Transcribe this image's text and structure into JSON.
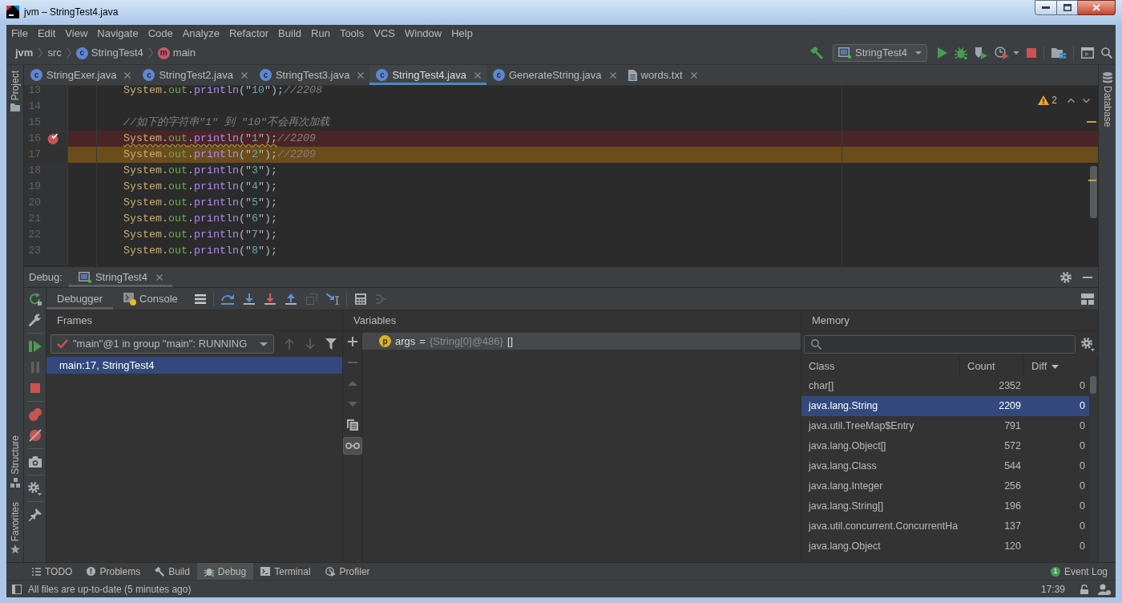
{
  "window": {
    "title": "jvm – StringTest4.java"
  },
  "menu": [
    "File",
    "Edit",
    "View",
    "Navigate",
    "Code",
    "Analyze",
    "Refactor",
    "Build",
    "Run",
    "Tools",
    "VCS",
    "Window",
    "Help"
  ],
  "breadcrumbs": [
    {
      "label": "jvm",
      "kind": "project"
    },
    {
      "label": "src",
      "kind": "folder"
    },
    {
      "label": "StringTest4",
      "kind": "class",
      "icon_letter": "c"
    },
    {
      "label": "main",
      "kind": "method",
      "icon_letter": "m"
    }
  ],
  "run_configuration": "StringTest4",
  "editor_tabs": [
    {
      "label": "StringExer.java",
      "kind": "class",
      "icon_letter": "c",
      "selected": false
    },
    {
      "label": "StringTest2.java",
      "kind": "class",
      "icon_letter": "c",
      "selected": false
    },
    {
      "label": "StringTest3.java",
      "kind": "class",
      "icon_letter": "c",
      "selected": false
    },
    {
      "label": "StringTest4.java",
      "kind": "class",
      "icon_letter": "c",
      "selected": true
    },
    {
      "label": "GenerateString.java",
      "kind": "class",
      "icon_letter": "c",
      "selected": false
    },
    {
      "label": "words.txt",
      "kind": "text",
      "selected": false
    }
  ],
  "left_tool_windows": [
    {
      "label": "Project",
      "kind": "project"
    },
    {
      "label": "Structure",
      "kind": "structure"
    },
    {
      "label": "Favorites",
      "kind": "favorites"
    }
  ],
  "right_tool_windows": [
    {
      "label": "Database",
      "kind": "database"
    }
  ],
  "editor": {
    "warning_count": "2",
    "lines": [
      {
        "number": "13",
        "breakpoint": false,
        "current": false,
        "warning": false,
        "tokens": [
          {
            "text": "System",
            "kind": "class"
          },
          {
            "text": ".",
            "kind": "punct"
          },
          {
            "text": "out",
            "kind": "field"
          },
          {
            "text": ".",
            "kind": "punct"
          },
          {
            "text": "println",
            "kind": "method"
          },
          {
            "text": "(\"",
            "kind": "punct"
          },
          {
            "text": "10",
            "kind": "string"
          },
          {
            "text": "\");",
            "kind": "punct"
          },
          {
            "text": "//2208",
            "kind": "comment"
          }
        ]
      },
      {
        "number": "14",
        "breakpoint": false,
        "current": false,
        "warning": false
      },
      {
        "number": "15",
        "breakpoint": false,
        "current": false,
        "warning": false,
        "tokens": [
          {
            "text": "//如下的字符串\"1\" 到 \"10\"不会再次加载",
            "kind": "comment"
          }
        ]
      },
      {
        "number": "16",
        "breakpoint": true,
        "current": false,
        "warning": true,
        "tokens": [
          {
            "text": "System",
            "kind": "class"
          },
          {
            "text": ".",
            "kind": "punct"
          },
          {
            "text": "out",
            "kind": "field"
          },
          {
            "text": ".",
            "kind": "punct"
          },
          {
            "text": "println",
            "kind": "method"
          },
          {
            "text": "(\"",
            "kind": "punct"
          },
          {
            "text": "1",
            "kind": "string"
          },
          {
            "text": "\");",
            "kind": "punct"
          },
          {
            "text": "//2209",
            "kind": "comment"
          }
        ]
      },
      {
        "number": "17",
        "breakpoint": false,
        "current": true,
        "warning": false,
        "tokens": [
          {
            "text": "System",
            "kind": "class"
          },
          {
            "text": ".",
            "kind": "punct"
          },
          {
            "text": "out",
            "kind": "field"
          },
          {
            "text": ".",
            "kind": "punct"
          },
          {
            "text": "println",
            "kind": "method"
          },
          {
            "text": "(\"",
            "kind": "punct"
          },
          {
            "text": "2",
            "kind": "string"
          },
          {
            "text": "\");",
            "kind": "punct"
          },
          {
            "text": "//2209",
            "kind": "comment"
          }
        ]
      },
      {
        "number": "18",
        "breakpoint": false,
        "current": false,
        "warning": false,
        "tokens": [
          {
            "text": "System",
            "kind": "class"
          },
          {
            "text": ".",
            "kind": "punct"
          },
          {
            "text": "out",
            "kind": "field"
          },
          {
            "text": ".",
            "kind": "punct"
          },
          {
            "text": "println",
            "kind": "method"
          },
          {
            "text": "(\"",
            "kind": "punct"
          },
          {
            "text": "3",
            "kind": "string"
          },
          {
            "text": "\");",
            "kind": "punct"
          }
        ]
      },
      {
        "number": "19",
        "breakpoint": false,
        "current": false,
        "warning": false,
        "tokens": [
          {
            "text": "System",
            "kind": "class"
          },
          {
            "text": ".",
            "kind": "punct"
          },
          {
            "text": "out",
            "kind": "field"
          },
          {
            "text": ".",
            "kind": "punct"
          },
          {
            "text": "println",
            "kind": "method"
          },
          {
            "text": "(\"",
            "kind": "punct"
          },
          {
            "text": "4",
            "kind": "string"
          },
          {
            "text": "\");",
            "kind": "punct"
          }
        ]
      },
      {
        "number": "20",
        "breakpoint": false,
        "current": false,
        "warning": false,
        "tokens": [
          {
            "text": "System",
            "kind": "class"
          },
          {
            "text": ".",
            "kind": "punct"
          },
          {
            "text": "out",
            "kind": "field"
          },
          {
            "text": ".",
            "kind": "punct"
          },
          {
            "text": "println",
            "kind": "method"
          },
          {
            "text": "(\"",
            "kind": "punct"
          },
          {
            "text": "5",
            "kind": "string"
          },
          {
            "text": "\");",
            "kind": "punct"
          }
        ]
      },
      {
        "number": "21",
        "breakpoint": false,
        "current": false,
        "warning": false,
        "tokens": [
          {
            "text": "System",
            "kind": "class"
          },
          {
            "text": ".",
            "kind": "punct"
          },
          {
            "text": "out",
            "kind": "field"
          },
          {
            "text": ".",
            "kind": "punct"
          },
          {
            "text": "println",
            "kind": "method"
          },
          {
            "text": "(\"",
            "kind": "punct"
          },
          {
            "text": "6",
            "kind": "string"
          },
          {
            "text": "\");",
            "kind": "punct"
          }
        ]
      },
      {
        "number": "22",
        "breakpoint": false,
        "current": false,
        "warning": false,
        "tokens": [
          {
            "text": "System",
            "kind": "class"
          },
          {
            "text": ".",
            "kind": "punct"
          },
          {
            "text": "out",
            "kind": "field"
          },
          {
            "text": ".",
            "kind": "punct"
          },
          {
            "text": "println",
            "kind": "method"
          },
          {
            "text": "(\"",
            "kind": "punct"
          },
          {
            "text": "7",
            "kind": "string"
          },
          {
            "text": "\");",
            "kind": "punct"
          }
        ]
      },
      {
        "number": "23",
        "breakpoint": false,
        "current": false,
        "warning": false,
        "tokens": [
          {
            "text": "System",
            "kind": "class"
          },
          {
            "text": ".",
            "kind": "punct"
          },
          {
            "text": "out",
            "kind": "field"
          },
          {
            "text": ".",
            "kind": "punct"
          },
          {
            "text": "println",
            "kind": "method"
          },
          {
            "text": "(\"",
            "kind": "punct"
          },
          {
            "text": "8",
            "kind": "string"
          },
          {
            "text": "\");",
            "kind": "punct"
          }
        ]
      }
    ]
  },
  "debug": {
    "label": "Debug:",
    "session_tab": "StringTest4",
    "tabs": [
      {
        "label": "Debugger",
        "kind": "debugger",
        "selected": true
      },
      {
        "label": "Console",
        "kind": "console",
        "selected": false
      }
    ],
    "frames": {
      "title": "Frames",
      "thread": "\"main\"@1 in group \"main\": RUNNING",
      "items": [
        {
          "label": "main:17, StringTest4",
          "selected": true
        }
      ]
    },
    "variables": {
      "title": "Variables",
      "inline_watches": true,
      "items": [
        {
          "icon_letter": "p",
          "name": "args",
          "operator": "=",
          "value": "{String[0]@486}",
          "contents": "[]",
          "selected": true
        }
      ]
    },
    "memory": {
      "title": "Memory",
      "columns": [
        {
          "label": "Class",
          "sorted": false
        },
        {
          "label": "Count",
          "sorted": false
        },
        {
          "label": "Diff",
          "sorted": true
        }
      ],
      "rows": [
        {
          "class": "char[]",
          "count": "2352",
          "diff": "0",
          "selected": false
        },
        {
          "class": "java.lang.String",
          "count": "2209",
          "diff": "0",
          "selected": true
        },
        {
          "class": "java.util.TreeMap$Entry",
          "count": "791",
          "diff": "0",
          "selected": false
        },
        {
          "class": "java.lang.Object[]",
          "count": "572",
          "diff": "0",
          "selected": false
        },
        {
          "class": "java.lang.Class",
          "count": "544",
          "diff": "0",
          "selected": false
        },
        {
          "class": "java.lang.Integer",
          "count": "256",
          "diff": "0",
          "selected": false
        },
        {
          "class": "java.lang.String[]",
          "count": "196",
          "diff": "0",
          "selected": false
        },
        {
          "class": "java.util.concurrent.ConcurrentHa",
          "count": "137",
          "diff": "0",
          "selected": false
        },
        {
          "class": "java.lang.Object",
          "count": "120",
          "diff": "0",
          "selected": false
        }
      ]
    }
  },
  "bottom_tools": [
    {
      "label": "TODO",
      "kind": "todo",
      "selected": false
    },
    {
      "label": "Problems",
      "kind": "problems",
      "selected": false
    },
    {
      "label": "Build",
      "kind": "build",
      "selected": false
    },
    {
      "label": "Debug",
      "kind": "debug",
      "selected": true
    },
    {
      "label": "Terminal",
      "kind": "terminal",
      "selected": false
    },
    {
      "label": "Profiler",
      "kind": "profiler",
      "selected": false
    }
  ],
  "event_log": {
    "label": "Event Log",
    "count": "1"
  },
  "status_bar": {
    "message": "All files are up-to-date (5 minutes ago)",
    "time": "17:39"
  }
}
